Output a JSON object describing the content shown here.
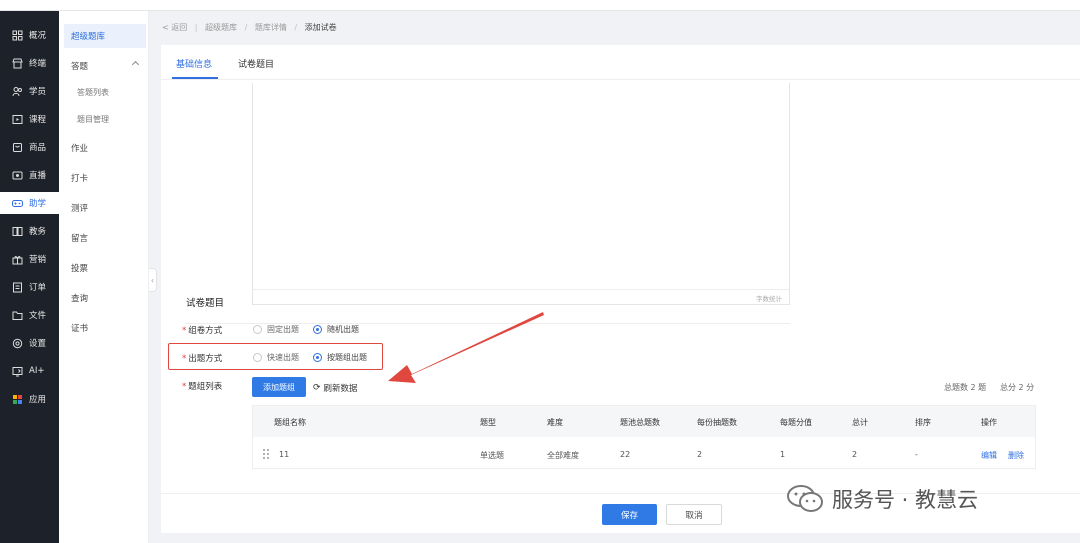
{
  "nav_primary": [
    {
      "label": "概况",
      "icon": "grid-icon"
    },
    {
      "label": "终端",
      "icon": "store-icon"
    },
    {
      "label": "学员",
      "icon": "users-icon"
    },
    {
      "label": "课程",
      "icon": "play-icon"
    },
    {
      "label": "商品",
      "icon": "box-icon"
    },
    {
      "label": "直播",
      "icon": "live-icon"
    },
    {
      "label": "助学",
      "icon": "gamepad-icon",
      "active": true
    },
    {
      "label": "教务",
      "icon": "book-icon"
    },
    {
      "label": "营销",
      "icon": "gift-icon"
    },
    {
      "label": "订单",
      "icon": "order-icon"
    },
    {
      "label": "文件",
      "icon": "folder-icon"
    },
    {
      "label": "设置",
      "icon": "gear-icon"
    },
    {
      "label": "AI+",
      "icon": "ai-icon"
    },
    {
      "label": "应用",
      "icon": "apps-icon"
    }
  ],
  "nav_secondary": [
    {
      "label": "超级题库",
      "active": true
    },
    {
      "label": "答题",
      "expandable": true
    },
    {
      "label": "答题列表",
      "sub": true
    },
    {
      "label": "题目管理",
      "sub": true
    },
    {
      "label": "作业"
    },
    {
      "label": "打卡"
    },
    {
      "label": "测评"
    },
    {
      "label": "留言"
    },
    {
      "label": "投票"
    },
    {
      "label": "查询"
    },
    {
      "label": "证书"
    }
  ],
  "breadcrumb": {
    "back": "返回",
    "items": [
      "超级题库",
      "题库详情",
      "添加试卷"
    ]
  },
  "tabs": [
    "基础信息",
    "试卷题目"
  ],
  "editor": {
    "word_count": "字数统计"
  },
  "section_title": "试卷题目",
  "form": {
    "compose": {
      "label": "组卷方式",
      "options": [
        "固定出题",
        "随机出题"
      ],
      "selected": 1
    },
    "mode": {
      "label": "出题方式",
      "options": [
        "快速出题",
        "按题组出题"
      ],
      "selected": 1
    },
    "group_list": {
      "label": "题组列表"
    }
  },
  "actions": {
    "add_group": "添加题组",
    "refresh": "刷新数据"
  },
  "totals": {
    "count": "总题数 2 题",
    "score": "总分 2 分"
  },
  "table": {
    "headers": [
      "题组名称",
      "题型",
      "难度",
      "题池总题数",
      "每份抽题数",
      "每题分值",
      "总计",
      "排序",
      "操作"
    ],
    "rows": [
      {
        "name": "11",
        "type": "单选题",
        "difficulty": "全部难度",
        "pool": "22",
        "draw": "2",
        "score": "1",
        "total": "2",
        "sort": "-",
        "edit": "编辑",
        "delete": "删除"
      }
    ]
  },
  "footer": {
    "save": "保存",
    "cancel": "取消"
  },
  "watermark": "服务号 · 教慧云",
  "colors": {
    "primary": "#2f7ae5",
    "sidebar": "#1d2129",
    "highlight": "#e0473e"
  }
}
